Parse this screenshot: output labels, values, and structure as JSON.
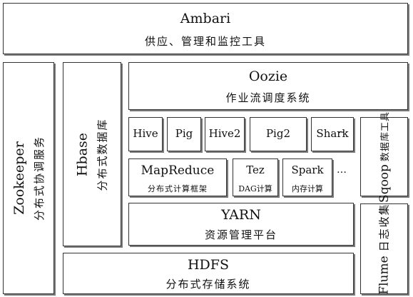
{
  "ambari": {
    "title": "Ambari",
    "subtitle": "供应、管理和监控工具"
  },
  "oozie": {
    "title": "Oozie",
    "subtitle": "作业流调度系统"
  },
  "zookeeper": {
    "title": "Zookeeper",
    "subtitle": "分布式协调服务"
  },
  "hbase": {
    "title": "Hbase",
    "subtitle": "分布式数据库"
  },
  "engines": {
    "hive": "Hive",
    "pig": "Pig",
    "hive2": "Hive2",
    "pig2": "Pig2",
    "shark": "Shark",
    "ellipsis": "…"
  },
  "mapreduce": {
    "title": "MapReduce",
    "subtitle": "分布式计算框架"
  },
  "tez": {
    "title": "Tez",
    "subtitle": "DAG计算"
  },
  "spark": {
    "title": "Spark",
    "subtitle": "内存计算"
  },
  "compute_ellipsis": "…",
  "sqoop": {
    "title": "Sqoop",
    "subtitle": "数据库工具"
  },
  "yarn": {
    "title": "YARN",
    "subtitle": "资源管理平台"
  },
  "flume": {
    "title": "Flume",
    "subtitle": "日志收集"
  },
  "hdfs": {
    "title": "HDFS",
    "subtitle": "分布式存储系统"
  }
}
